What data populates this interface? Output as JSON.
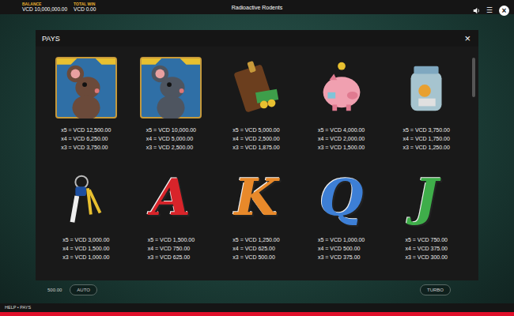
{
  "top_bar": {
    "balance_label": "BALANCE",
    "balance_value": "VCD 10,000,000.00",
    "win_label": "TOTAL WIN",
    "win_value": "VCD 0.00",
    "title": "Radioactive Rodents",
    "menu_glyph": "☰",
    "close_glyph": "×"
  },
  "background_controls": {
    "bet_value": "500.00",
    "auto_button": "AUTO",
    "turbo_button": "TURBO"
  },
  "pays": {
    "title": "PAYS",
    "close_glyph": "×",
    "scroll_level": 0.8,
    "symbols": [
      {
        "kind": "rat",
        "color": "#6b4a3a",
        "pays": [
          "x5 = VCD 12,500.00",
          "x4 = VCD 6,250.00",
          "x3 = VCD 3,750.00"
        ]
      },
      {
        "kind": "rat",
        "color": "#4e5560",
        "pays": [
          "x5 = VCD 10,000.00",
          "x4 = VCD 5,000.00",
          "x3 = VCD 2,500.00"
        ]
      },
      {
        "kind": "wallet",
        "pays": [
          "x5 = VCD 5,000.00",
          "x4 = VCD 2,500.00",
          "x3 = VCD 1,875.00"
        ]
      },
      {
        "kind": "piggy",
        "pays": [
          "x5 = VCD 4,000.00",
          "x4 = VCD 2,000.00",
          "x3 = VCD 1,500.00"
        ]
      },
      {
        "kind": "jar",
        "pays": [
          "x5 = VCD 3,750.00",
          "x4 = VCD 1,750.00",
          "x3 = VCD 1,250.00"
        ]
      },
      {
        "kind": "keys",
        "pays": [
          "x5 = VCD 3,000.00",
          "x4 = VCD 1,500.00",
          "x3 = VCD 1,000.00"
        ]
      },
      {
        "kind": "letter",
        "letter": "A",
        "color": "#d8242a",
        "pays": [
          "x5 = VCD 1,500.00",
          "x4 = VCD 750.00",
          "x3 = VCD 625.00"
        ]
      },
      {
        "kind": "letter",
        "letter": "K",
        "color": "#e8892a",
        "pays": [
          "x5 = VCD 1,250.00",
          "x4 = VCD 625.00",
          "x3 = VCD 500.00"
        ]
      },
      {
        "kind": "letter",
        "letter": "Q",
        "color": "#3d7fd6",
        "pays": [
          "x5 = VCD 1,000.00",
          "x4 = VCD 500.00",
          "x3 = VCD 375.00"
        ]
      },
      {
        "kind": "letter",
        "letter": "J",
        "color": "#3fae4a",
        "pays": [
          "x5 = VCD 750.00",
          "x4 = VCD 375.00",
          "x3 = VCD 300.00"
        ]
      }
    ]
  },
  "breadcrumb": "HELP • PAYS"
}
